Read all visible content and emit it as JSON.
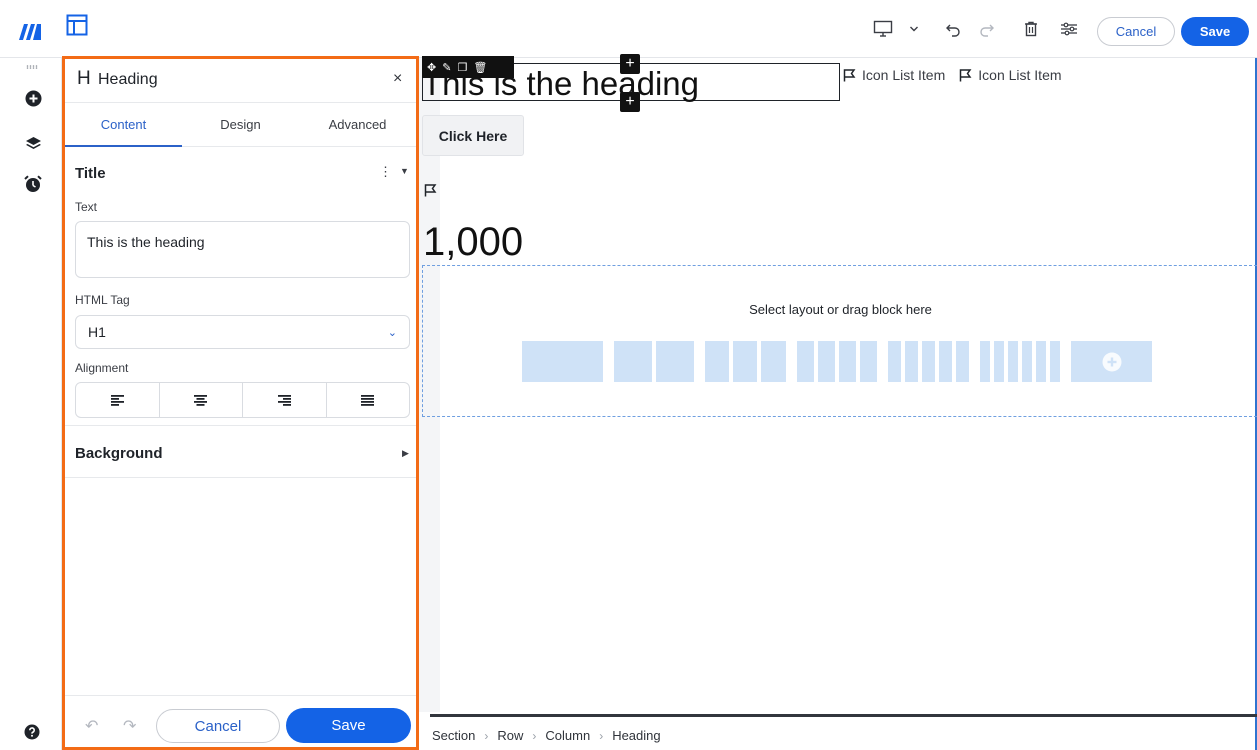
{
  "toolbar": {
    "device_icon": "desktop-icon",
    "undo_icon": "undo-icon",
    "redo_icon": "redo-icon",
    "delete_icon": "trash-icon",
    "settings_icon": "sliders-icon",
    "cancel_label": "Cancel",
    "save_label": "Save"
  },
  "rail": {
    "items": [
      {
        "icon": "add-circle-icon"
      },
      {
        "icon": "layers-icon"
      },
      {
        "icon": "alarm-clock-icon"
      }
    ],
    "help_icon": "help-icon"
  },
  "panel": {
    "title": "Heading",
    "close": "×",
    "tabs": [
      {
        "label": "Content",
        "active": true
      },
      {
        "label": "Design",
        "active": false
      },
      {
        "label": "Advanced",
        "active": false
      }
    ],
    "section_title": "Title",
    "text_label": "Text",
    "text_value": "This is the heading",
    "html_tag_label": "HTML Tag",
    "html_tag_value": "H1",
    "alignment_label": "Alignment",
    "alignment_options": [
      "left",
      "center",
      "right",
      "justify"
    ],
    "background_label": "Background",
    "cancel_label": "Cancel",
    "save_label": "Save"
  },
  "canvas": {
    "heading": "This is the heading",
    "icon_list": [
      "Icon List Item",
      "Icon List Item"
    ],
    "button_label": "Click Here",
    "counter": "1,000",
    "drop_zone_text": "Select layout or drag block here",
    "layout_column_counts": [
      1,
      2,
      3,
      4,
      5,
      6
    ]
  },
  "breadcrumb": [
    "Section",
    "Row",
    "Column",
    "Heading"
  ],
  "colors": {
    "accent": "#1463e6",
    "panel_border": "#f36b16",
    "frame_border": "#2f74d0",
    "layout_block": "#cfe2f7"
  }
}
